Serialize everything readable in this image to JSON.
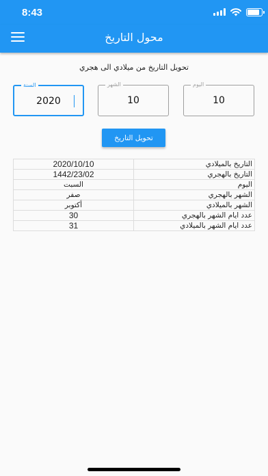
{
  "status_bar": {
    "time": "8:43"
  },
  "app_bar": {
    "title": "محول التاريخ",
    "menu_icon": "hamburger-menu-icon"
  },
  "main": {
    "subtitle": "تحويل التاريخ من ميلادي الى هجري",
    "fields": {
      "day": {
        "label": "اليوم",
        "value": "10"
      },
      "month": {
        "label": "الشهر",
        "value": "10"
      },
      "year": {
        "label": "السنة",
        "value": "2020"
      }
    },
    "convert_button": "تحويل التاريخ",
    "results": [
      {
        "label": "التاريخ بالميلادي",
        "value": "2020/10/10"
      },
      {
        "label": "التاريخ بالهجري",
        "value": "1442/23/02"
      },
      {
        "label": "اليوم",
        "value": "السبت"
      },
      {
        "label": "الشهر بالهجري",
        "value": "صفر"
      },
      {
        "label": "الشهر بالميلادي",
        "value": "أكتوبر"
      },
      {
        "label": "عدد ايام الشهر بالهجري",
        "value": "30"
      },
      {
        "label": "عدد ايام الشهر بالميلادي",
        "value": "31"
      }
    ]
  },
  "colors": {
    "primary": "#2196f3",
    "background": "#fafafa",
    "border": "#9e9e9e"
  }
}
